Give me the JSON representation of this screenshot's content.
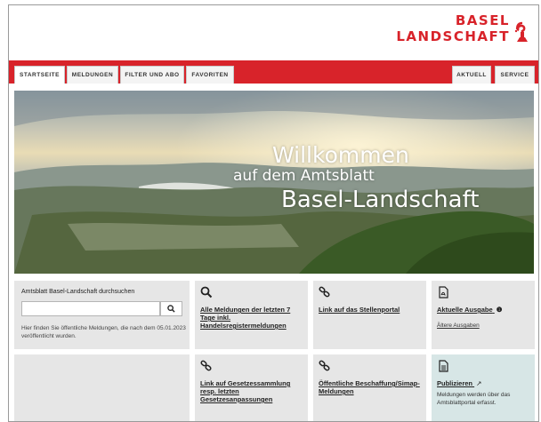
{
  "logo": {
    "line1": "BASEL",
    "line2": "LANDSCHAFT"
  },
  "nav": {
    "tabs": [
      {
        "label": "STARTSEITE",
        "active": true
      },
      {
        "label": "MELDUNGEN",
        "active": false
      },
      {
        "label": "FILTER UND ABO",
        "active": false
      },
      {
        "label": "FAVORITEN",
        "active": false
      }
    ],
    "right_tabs": [
      {
        "label": "AKTUELL"
      },
      {
        "label": "SERVICE"
      }
    ]
  },
  "hero": {
    "line1": "Willkommen",
    "line2": "auf dem Amtsblatt",
    "line3": "Basel-Landschaft"
  },
  "search": {
    "title": "Amtsblatt Basel-Landschaft durchsuchen",
    "placeholder": "",
    "hint": "Hier finden Sie öffentliche Meldungen, die nach dem 05.01.2023 veröffentlicht wurden."
  },
  "tiles": {
    "all_messages": {
      "icon": "search-icon",
      "label": "Alle Meldungen der letzten 7 Tage inkl. Handelsregistermeldungen"
    },
    "job_portal": {
      "icon": "link-icon",
      "label": "Link auf das Stellenportal"
    },
    "current_issue": {
      "icon": "pdf-icon",
      "label": "Aktuelle Ausgabe",
      "info": "❶",
      "sublink": "Ältere Ausgaben"
    },
    "law_collection": {
      "icon": "link-icon",
      "label": "Link auf Gesetzessammlung resp. letzten Gesetzesanpassungen"
    },
    "procurement": {
      "icon": "link-icon",
      "label": "Öffentliche Beschaffung/Simap-Meldungen"
    },
    "publish": {
      "icon": "document-icon",
      "label": "Publizieren",
      "external": "↗",
      "text": "Meldungen werden über das Amtsblattportal erfasst."
    }
  },
  "colors": {
    "brand_red": "#d8232a",
    "tile_gray": "#e6e6e6",
    "tile_teal": "#d7e6e6"
  }
}
